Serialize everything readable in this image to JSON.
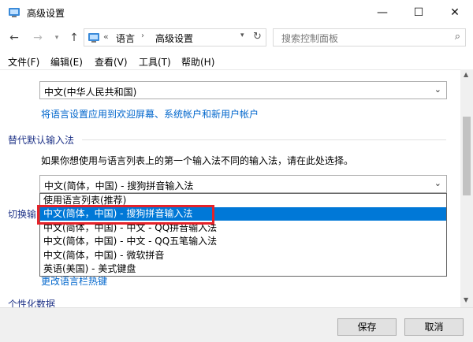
{
  "window": {
    "title": "高级设置",
    "minimize": "—",
    "maximize": "☐",
    "close": "✕"
  },
  "nav": {
    "back": "←",
    "forward": "→",
    "history_dropdown": "▾",
    "up": "↑",
    "address_sep": "«",
    "path": [
      "语言",
      "高级设置"
    ],
    "path_arrow": "›",
    "address_dropdown": "▾",
    "refresh": "↻",
    "search_placeholder": "搜索控制面板",
    "search_glyph": "⌕"
  },
  "menu": [
    "文件(F)",
    "编辑(E)",
    "查看(V)",
    "工具(T)",
    "帮助(H)"
  ],
  "content": {
    "locale_combo": "中文(中华人民共和国)",
    "apply_link": "将语言设置应用到欢迎屏幕、系统帐户和新用户帐户",
    "ime_section_title": "替代默认输入法",
    "ime_description": "如果你想使用与语言列表上的第一个输入法不同的输入法，请在此处选择。",
    "ime_combo": "中文(简体，中国) - 搜狗拼音输入法",
    "partial_section": "切换输",
    "partial_link": "更改语言栏热键",
    "bottom_partial": "个性化数据",
    "combo_arrow": "⌄"
  },
  "dropdown": {
    "options": [
      "使用语言列表(推荐)",
      "中文(简体，中国) - 搜狗拼音输入法",
      "中文(简体，中国) - 中文 - QQ拼音输入法",
      "中文(简体，中国) - 中文 - QQ五笔输入法",
      "中文(简体，中国) - 微软拼音",
      "英语(美国) - 美式键盘"
    ],
    "selected_index": 1
  },
  "scrollbar": {
    "up": "▲",
    "down": "▼"
  },
  "buttons": {
    "save": "保存",
    "cancel": "取消"
  },
  "colors": {
    "accent": "#0078d7",
    "link": "#0066cc",
    "highlight_box": "#e5222a"
  }
}
